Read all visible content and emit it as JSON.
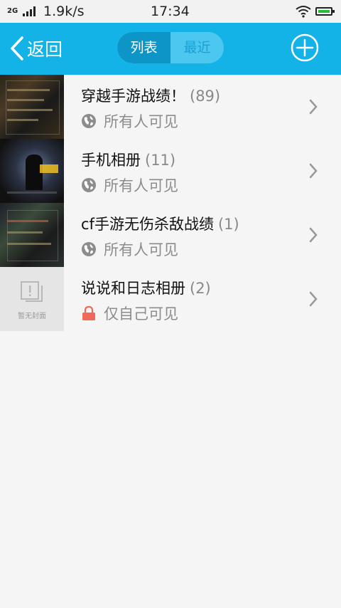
{
  "status_bar": {
    "network": "2G",
    "speed": "1.9k/s",
    "time": "17:34"
  },
  "header": {
    "back_label": "返回",
    "tabs": [
      {
        "label": "列表",
        "active": true
      },
      {
        "label": "最近",
        "active": false
      }
    ]
  },
  "albums": [
    {
      "title": "穿越手游战绩！",
      "count": "(89)",
      "privacy_icon": "globe-icon",
      "privacy": "所有人可见"
    },
    {
      "title": "手机相册",
      "count": "(11)",
      "privacy_icon": "globe-icon",
      "privacy": "所有人可见"
    },
    {
      "title": "cf手游无伤杀敌战绩",
      "count": "(1)",
      "privacy_icon": "globe-icon",
      "privacy": "所有人可见"
    },
    {
      "title": "说说和日志相册",
      "count": "(2)",
      "privacy_icon": "lock-icon",
      "privacy": "仅自己可见",
      "cover_placeholder": "暂无封面"
    }
  ],
  "colors": {
    "header": "#13b3e8",
    "active_tab": "#0d95c7",
    "lock": "#f06a5a",
    "globe": "#8c8c8c"
  }
}
